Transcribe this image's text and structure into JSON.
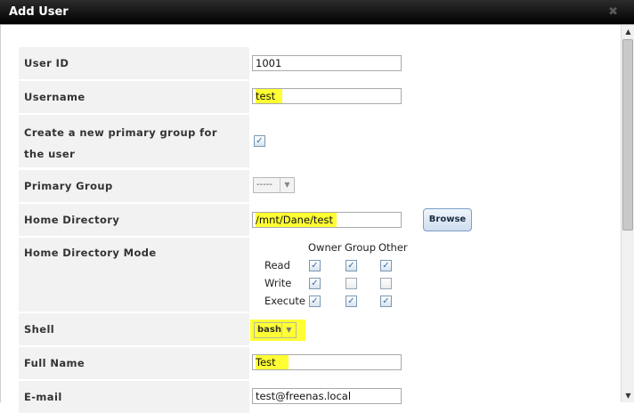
{
  "dialog": {
    "title": "Add User",
    "close_glyph": "✖"
  },
  "form": {
    "user_id": {
      "label": "User ID",
      "value": "1001"
    },
    "username": {
      "label": "Username",
      "value": "test"
    },
    "create_group": {
      "label": "Create a new primary group for the user",
      "checked": true
    },
    "primary_group": {
      "label": "Primary Group",
      "value": "-----"
    },
    "home_directory": {
      "label": "Home Directory",
      "value": "/mnt/Dane/test",
      "browse_label": "Browse"
    },
    "home_directory_mode": {
      "label": "Home Directory Mode",
      "columns": [
        "Owner",
        "Group",
        "Other"
      ],
      "rows": [
        {
          "name": "Read",
          "values": [
            true,
            true,
            true
          ]
        },
        {
          "name": "Write",
          "values": [
            true,
            false,
            false
          ]
        },
        {
          "name": "Execute",
          "values": [
            true,
            true,
            true
          ]
        }
      ]
    },
    "shell": {
      "label": "Shell",
      "value": "bash"
    },
    "full_name": {
      "label": "Full Name",
      "value": "Test"
    },
    "email": {
      "label": "E-mail",
      "value": "test@freenas.local"
    }
  },
  "colors": {
    "highlight": "#ffff33",
    "label_bg": "#f2f2f2",
    "titlebar": "#000000"
  }
}
